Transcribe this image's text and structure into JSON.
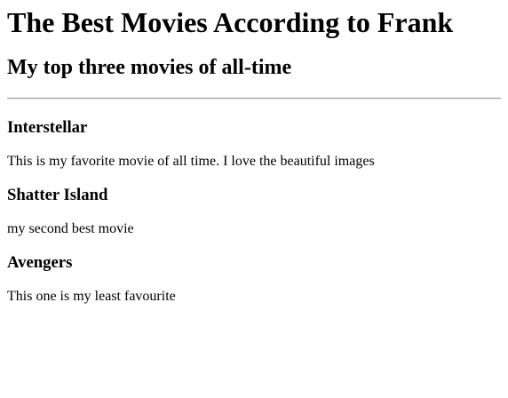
{
  "page": {
    "title": "The Best Movies According to Frank",
    "subtitle": "My top three movies of all-time"
  },
  "movies": [
    {
      "title": "Interstellar",
      "description": "This is my favorite movie of all time. I love the beautiful images"
    },
    {
      "title": "Shatter Island",
      "description": "my second best movie"
    },
    {
      "title": "Avengers",
      "description": "This one is my least favourite"
    }
  ]
}
